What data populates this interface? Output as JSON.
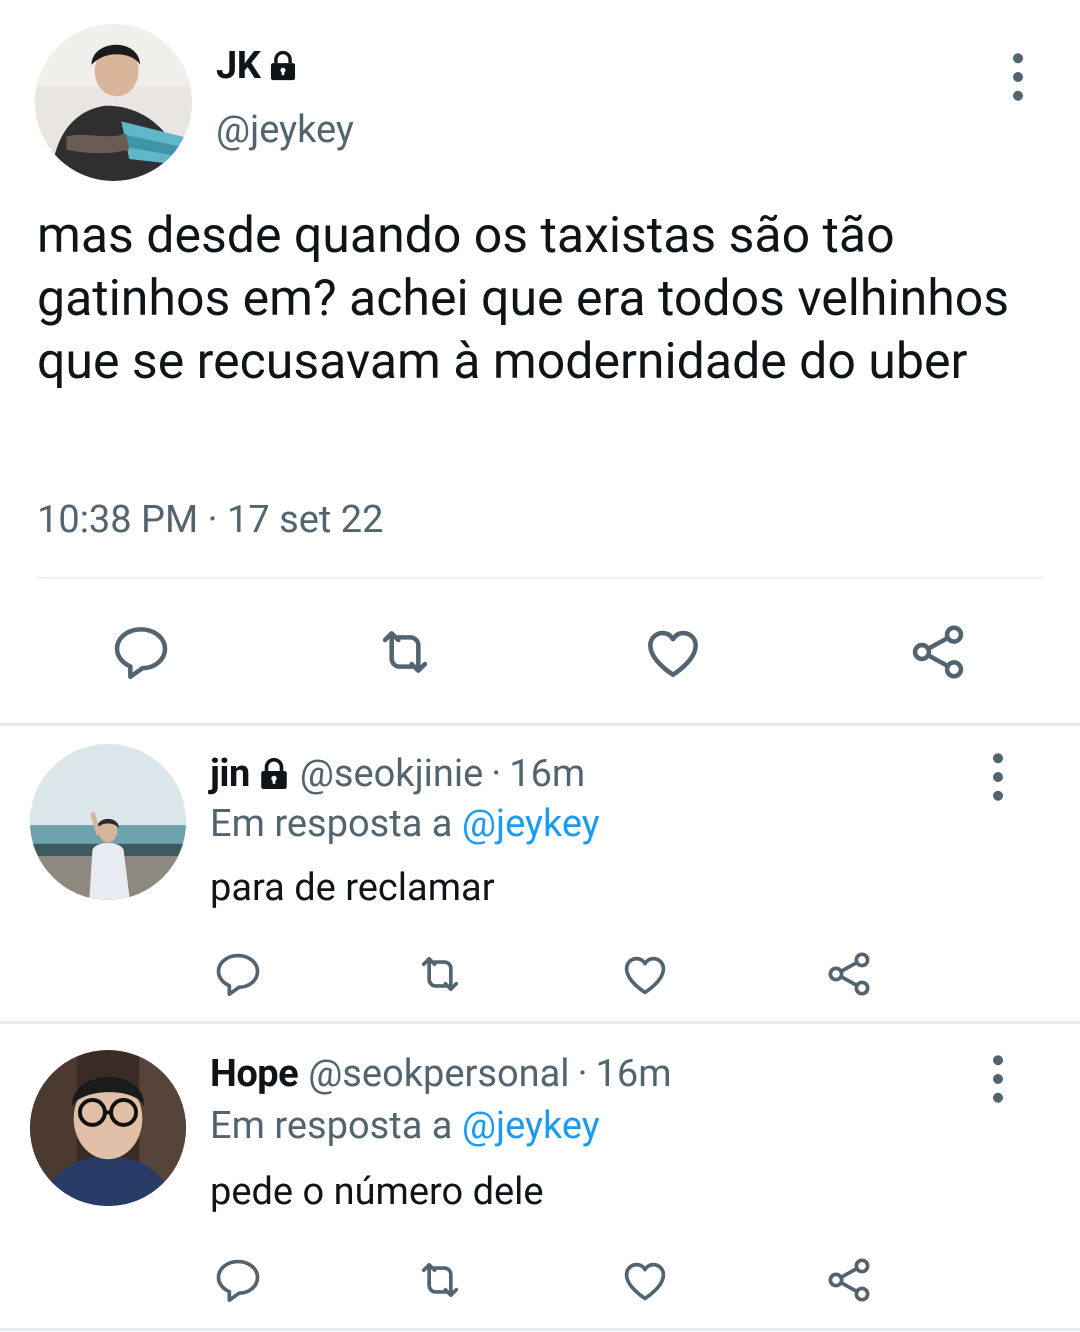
{
  "main_tweet": {
    "name": "JK",
    "handle": "@jeykey",
    "text": "mas desde quando os taxistas são tão gatinhos em? achei que era todos velhinhos que se recusavam à modernidade do uber",
    "timestamp": "10:38 PM · 17 set 22",
    "icons": [
      "lock-icon",
      "more-vertical-icon",
      "reply-icon",
      "retweet-icon",
      "like-icon",
      "share-icon"
    ]
  },
  "replies": [
    {
      "name": "jin",
      "locked": true,
      "handle": "@seokjinie",
      "separator": "·",
      "time": "16m",
      "reply_prefix": "Em resposta a",
      "reply_to": "@jeykey",
      "text": "para de reclamar"
    },
    {
      "name": "Hope",
      "locked": false,
      "handle": "@seokpersonal",
      "separator": "·",
      "time": "16m",
      "reply_prefix": "Em resposta a",
      "reply_to": "@jeykey",
      "text": "pede o número dele"
    }
  ],
  "colors": {
    "text": "#0f1419",
    "secondary": "#536471",
    "link": "#1d9bf0",
    "divider": "#e6ecf0"
  }
}
